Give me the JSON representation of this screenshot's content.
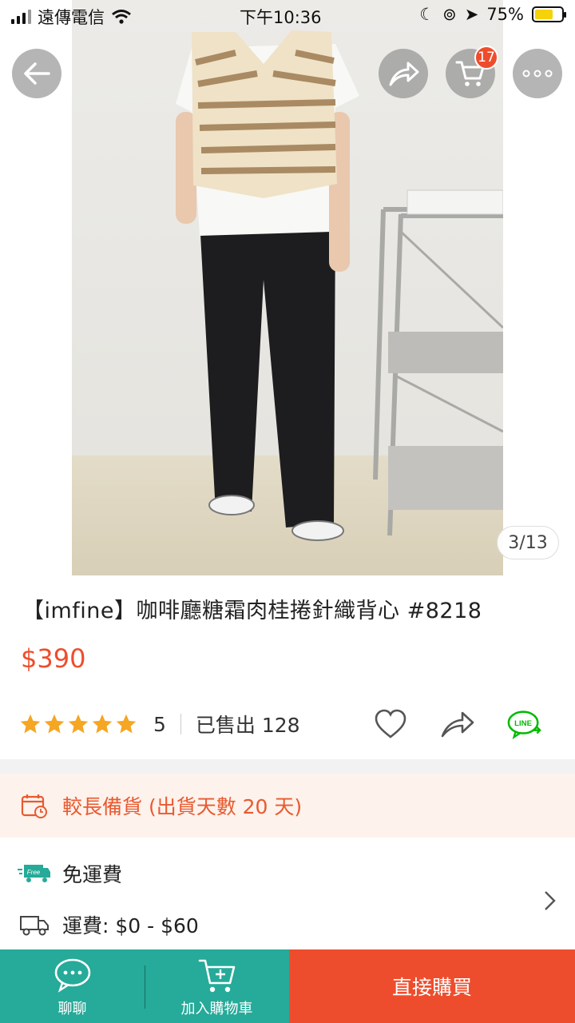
{
  "status_bar": {
    "carrier": "遠傳電信",
    "time": "下午10:36",
    "battery": "75%"
  },
  "nav": {
    "back_icon": "arrow-left-icon",
    "share_icon": "share-icon",
    "cart_icon": "cart-icon",
    "cart_count": "17",
    "more_icon": "more-dots-icon"
  },
  "image_counter": "3/13",
  "product": {
    "title": "【imfine】咖啡廳糖霜肉桂捲針織背心 #8218",
    "price": "$390",
    "rating": "5",
    "rating_stars": 5,
    "sold": "已售出 128"
  },
  "preorder_notice": "較長備貨 (出貨天數 20 天)",
  "shipping": {
    "free_label": "免運費",
    "free_badge": "Free",
    "fee_label": "運費: $0 - $60"
  },
  "line_badge": "LINE",
  "bottom_bar": {
    "chat_label": "聊聊",
    "add_cart_label": "加入購物車",
    "buy_label": "直接購買"
  },
  "colors": {
    "accent": "#ee4d2d",
    "teal": "#26aa99",
    "line_green": "#00b900",
    "star": "#f5a623"
  }
}
